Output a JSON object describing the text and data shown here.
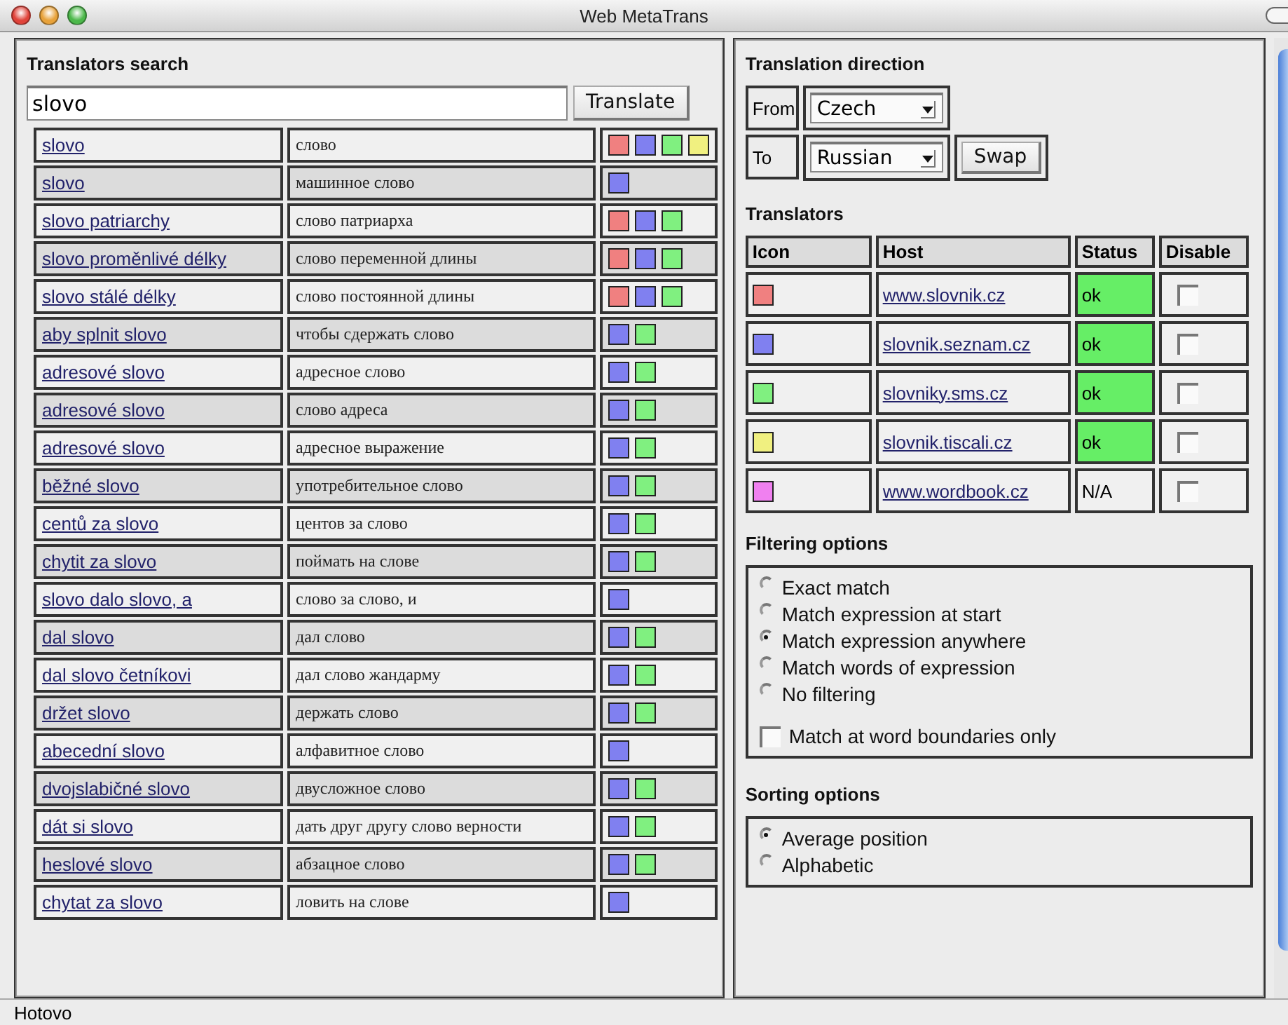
{
  "window": {
    "title": "Web MetaTrans"
  },
  "search": {
    "title": "Translators search",
    "value": "slovo",
    "button": "Translate",
    "results": [
      {
        "term": "slovo",
        "translation": "слово",
        "sources": [
          {
            "color": "#f08080"
          },
          {
            "color": "#8080f0"
          },
          {
            "color": "#80f080"
          },
          {
            "color": "#f0f080"
          }
        ]
      },
      {
        "term": "slovo",
        "translation": "машинное слово",
        "sources": [
          {
            "color": "#8080f0"
          }
        ]
      },
      {
        "term": "slovo patriarchy",
        "translation": "слово патриарха",
        "sources": [
          {
            "color": "#f08080"
          },
          {
            "color": "#8080f0"
          },
          {
            "color": "#80f080"
          }
        ]
      },
      {
        "term": "slovo proměnlivé délky",
        "translation": "слово переменной длины",
        "sources": [
          {
            "color": "#f08080"
          },
          {
            "color": "#8080f0"
          },
          {
            "color": "#80f080"
          }
        ]
      },
      {
        "term": "slovo stálé délky",
        "translation": "слово постоянной длины",
        "sources": [
          {
            "color": "#f08080"
          },
          {
            "color": "#8080f0"
          },
          {
            "color": "#80f080"
          }
        ]
      },
      {
        "term": "aby splnit slovo",
        "translation": "чтобы сдержать слово",
        "sources": [
          {
            "color": "#8080f0"
          },
          {
            "color": "#80f080"
          }
        ]
      },
      {
        "term": "adresové slovo",
        "translation": "адресное слово",
        "sources": [
          {
            "color": "#8080f0"
          },
          {
            "color": "#80f080"
          }
        ]
      },
      {
        "term": "adresové slovo",
        "translation": "слово адреса",
        "sources": [
          {
            "color": "#8080f0"
          },
          {
            "color": "#80f080"
          }
        ]
      },
      {
        "term": "adresové slovo",
        "translation": "адресное выражение",
        "sources": [
          {
            "color": "#8080f0"
          },
          {
            "color": "#80f080"
          }
        ]
      },
      {
        "term": "běžné slovo",
        "translation": "употребительное слово",
        "sources": [
          {
            "color": "#8080f0"
          },
          {
            "color": "#80f080"
          }
        ]
      },
      {
        "term": "centů za slovo",
        "translation": "центов за слово",
        "sources": [
          {
            "color": "#8080f0"
          },
          {
            "color": "#80f080"
          }
        ]
      },
      {
        "term": "chytit za slovo",
        "translation": "поймать на слове",
        "sources": [
          {
            "color": "#8080f0"
          },
          {
            "color": "#80f080"
          }
        ]
      },
      {
        "term": "slovo dalo slovo, a",
        "translation": "слово за слово, и",
        "sources": [
          {
            "color": "#8080f0"
          }
        ]
      },
      {
        "term": "dal slovo",
        "translation": "дал слово",
        "sources": [
          {
            "color": "#8080f0"
          },
          {
            "color": "#80f080"
          }
        ]
      },
      {
        "term": "dal slovo četníkovi",
        "translation": "дал слово жандарму",
        "sources": [
          {
            "color": "#8080f0"
          },
          {
            "color": "#80f080"
          }
        ]
      },
      {
        "term": "držet slovo",
        "translation": "держать слово",
        "sources": [
          {
            "color": "#8080f0"
          },
          {
            "color": "#80f080"
          }
        ]
      },
      {
        "term": "abecední slovo",
        "translation": "алфавитное слово",
        "sources": [
          {
            "color": "#8080f0"
          }
        ]
      },
      {
        "term": "dvojslabičné slovo",
        "translation": "двусложное слово",
        "sources": [
          {
            "color": "#8080f0"
          },
          {
            "color": "#80f080"
          }
        ]
      },
      {
        "term": "dát si slovo",
        "translation": "дать друг другу слово верности",
        "sources": [
          {
            "color": "#8080f0"
          },
          {
            "color": "#80f080"
          }
        ]
      },
      {
        "term": "heslové slovo",
        "translation": "абзацное слово",
        "sources": [
          {
            "color": "#8080f0"
          },
          {
            "color": "#80f080"
          }
        ]
      },
      {
        "term": "chytat za slovo",
        "translation": "ловить на слове",
        "sources": [
          {
            "color": "#8080f0"
          }
        ]
      }
    ]
  },
  "direction": {
    "title": "Translation direction",
    "from_label": "From",
    "from_value": "Czech",
    "to_label": "To",
    "to_value": "Russian",
    "swap": "Swap"
  },
  "translators": {
    "title": "Translators",
    "columns": [
      "Icon",
      "Host",
      "Status",
      "Disable"
    ],
    "rows": [
      {
        "color": "#f08080",
        "host": "www.slovnik.cz",
        "status": "ok",
        "available": true,
        "disabled": false
      },
      {
        "color": "#8080f0",
        "host": "slovnik.seznam.cz",
        "status": "ok",
        "available": true,
        "disabled": false
      },
      {
        "color": "#80f080",
        "host": "slovniky.sms.cz",
        "status": "ok",
        "available": true,
        "disabled": false
      },
      {
        "color": "#f0f080",
        "host": "slovnik.tiscali.cz",
        "status": "ok",
        "available": true,
        "disabled": false
      },
      {
        "color": "#f080f0",
        "host": "www.wordbook.cz",
        "status": "N/A",
        "available": false,
        "disabled": false
      }
    ]
  },
  "filtering": {
    "title": "Filtering options",
    "options": [
      {
        "label": "Exact match",
        "selected": false
      },
      {
        "label": "Match expression at start",
        "selected": false
      },
      {
        "label": "Match expression anywhere",
        "selected": true
      },
      {
        "label": "Match words of expression",
        "selected": false
      },
      {
        "label": "No filtering",
        "selected": false
      }
    ],
    "checkbox": {
      "label": "Match at word boundaries only",
      "checked": false
    }
  },
  "sorting": {
    "title": "Sorting options",
    "options": [
      {
        "label": "Average position",
        "selected": true
      },
      {
        "label": "Alphabetic",
        "selected": false
      }
    ]
  },
  "status_bar": "Hotovo"
}
